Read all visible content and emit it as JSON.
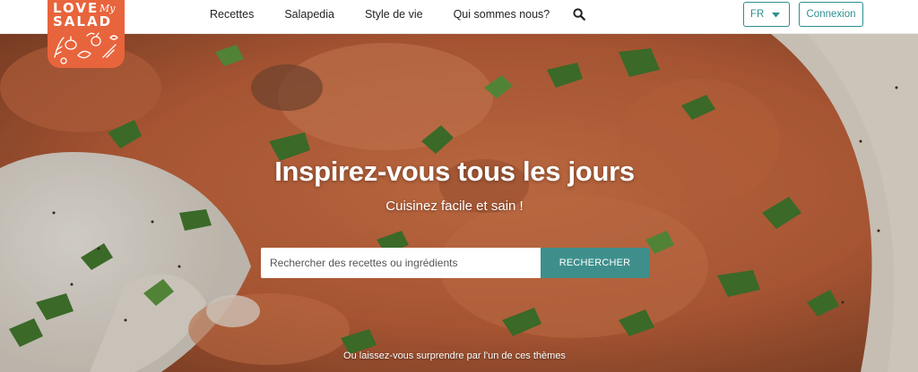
{
  "logo": {
    "line1": "LOVE",
    "line2": "My",
    "line3": "SALAD",
    "color": "#e8643c"
  },
  "nav": {
    "items": [
      "Recettes",
      "Salapedia",
      "Style de vie",
      "Qui sommes nous?"
    ],
    "search_icon": "search-icon"
  },
  "language": {
    "selected": "FR",
    "icon": "chevron-down-icon"
  },
  "auth": {
    "login_label": "Connexion"
  },
  "hero": {
    "title": "Inspirez-vous tous les jours",
    "subtitle": "Cuisinez facile et sain !",
    "search_placeholder": "Rechercher des recettes ou ingrédients",
    "search_button": "RECHERCHER",
    "note": "Ou laissez-vous surprendre par l'un de ces thèmes"
  },
  "colors": {
    "accent": "#2e8f8f",
    "button": "#3e8f8c",
    "brand": "#e8643c"
  }
}
